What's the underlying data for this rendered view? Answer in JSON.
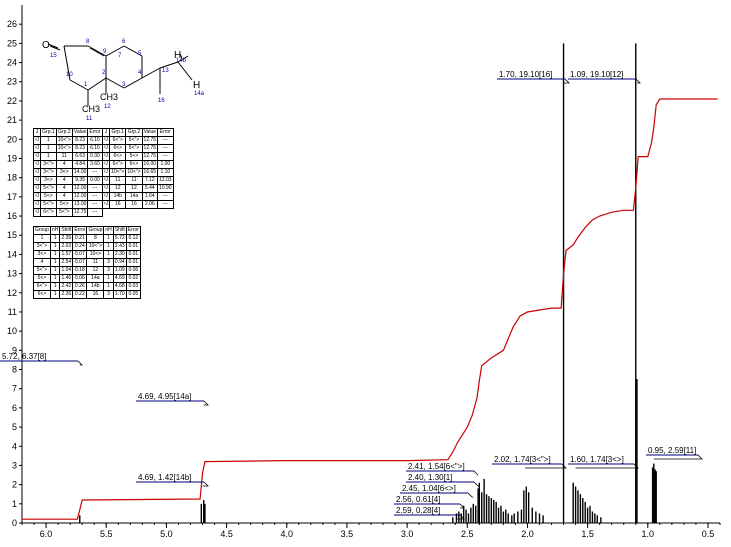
{
  "chart_data": {
    "type": "line",
    "title": "",
    "xlabel": "",
    "ylabel": "",
    "xlim": [
      6.2,
      0.4
    ],
    "ylim": [
      0,
      27
    ],
    "x_reversed": true,
    "x_ticks": [
      "6.0",
      "5.5",
      "5.0",
      "4.5",
      "4.0",
      "3.5",
      "3.0",
      "2.5",
      "2.0",
      "1.5",
      "1.0",
      "0.5"
    ],
    "y_ticks": [
      "0",
      "1",
      "2",
      "3",
      "4",
      "5",
      "6",
      "7",
      "8",
      "9",
      "10",
      "11",
      "12",
      "13",
      "14",
      "15",
      "16",
      "17",
      "18",
      "19",
      "20",
      "21",
      "22",
      "23",
      "24",
      "25",
      "26"
    ],
    "grid": false,
    "colors": {
      "integral": "#cc0000",
      "spectrum": "#000000",
      "label_border": "#000080"
    },
    "integral_curve": {
      "x": [
        6.2,
        5.74,
        5.72,
        5.7,
        4.72,
        4.7,
        4.68,
        4.0,
        3.0,
        2.66,
        2.62,
        2.58,
        2.54,
        2.5,
        2.46,
        2.42,
        2.4,
        2.38,
        2.3,
        2.2,
        2.12,
        2.06,
        2.0,
        1.9,
        1.8,
        1.72,
        1.7,
        1.68,
        1.62,
        1.58,
        1.52,
        1.46,
        1.4,
        1.3,
        1.2,
        1.12,
        1.1,
        1.08,
        1.0,
        0.97,
        0.95,
        0.93,
        0.9,
        0.6,
        0.42
      ],
      "y": [
        0.2,
        0.2,
        0.7,
        1.2,
        1.25,
        2.6,
        3.2,
        3.25,
        3.25,
        3.3,
        3.7,
        4.2,
        4.6,
        5.0,
        5.6,
        6.5,
        7.4,
        8.2,
        8.6,
        9.0,
        10.2,
        10.8,
        11.0,
        11.1,
        11.2,
        11.2,
        13.0,
        14.2,
        14.5,
        14.9,
        15.4,
        15.8,
        16.0,
        16.2,
        16.3,
        16.3,
        17.5,
        19.1,
        19.1,
        19.8,
        20.6,
        21.8,
        22.1,
        22.1,
        22.1
      ]
    },
    "peaks": [
      {
        "x": 5.72,
        "h": 0.4
      },
      {
        "x": 4.71,
        "h": 1.0
      },
      {
        "x": 4.69,
        "h": 1.2
      },
      {
        "x": 4.68,
        "h": 1.0
      },
      {
        "x": 2.62,
        "h": 0.3
      },
      {
        "x": 2.59,
        "h": 0.5
      },
      {
        "x": 2.57,
        "h": 0.6
      },
      {
        "x": 2.55,
        "h": 0.5
      },
      {
        "x": 2.53,
        "h": 0.9
      },
      {
        "x": 2.51,
        "h": 0.7
      },
      {
        "x": 2.49,
        "h": 0.5
      },
      {
        "x": 2.47,
        "h": 0.8
      },
      {
        "x": 2.45,
        "h": 1.0
      },
      {
        "x": 2.43,
        "h": 0.9
      },
      {
        "x": 2.41,
        "h": 1.8
      },
      {
        "x": 2.4,
        "h": 2.1
      },
      {
        "x": 2.38,
        "h": 1.6
      },
      {
        "x": 2.36,
        "h": 2.3
      },
      {
        "x": 2.34,
        "h": 1.5
      },
      {
        "x": 2.32,
        "h": 1.4
      },
      {
        "x": 2.3,
        "h": 1.3
      },
      {
        "x": 2.28,
        "h": 1.2
      },
      {
        "x": 2.26,
        "h": 1.1
      },
      {
        "x": 2.24,
        "h": 0.8
      },
      {
        "x": 2.22,
        "h": 0.9
      },
      {
        "x": 2.2,
        "h": 0.6
      },
      {
        "x": 2.18,
        "h": 0.7
      },
      {
        "x": 2.16,
        "h": 0.5
      },
      {
        "x": 2.13,
        "h": 0.4
      },
      {
        "x": 2.11,
        "h": 0.5
      },
      {
        "x": 2.08,
        "h": 0.6
      },
      {
        "x": 2.05,
        "h": 0.7
      },
      {
        "x": 2.03,
        "h": 1.7
      },
      {
        "x": 2.01,
        "h": 1.9
      },
      {
        "x": 1.99,
        "h": 1.6
      },
      {
        "x": 1.96,
        "h": 0.8
      },
      {
        "x": 1.93,
        "h": 0.6
      },
      {
        "x": 1.9,
        "h": 0.5
      },
      {
        "x": 1.87,
        "h": 0.4
      },
      {
        "x": 1.62,
        "h": 2.1
      },
      {
        "x": 1.6,
        "h": 1.9
      },
      {
        "x": 1.58,
        "h": 1.7
      },
      {
        "x": 1.56,
        "h": 1.5
      },
      {
        "x": 1.54,
        "h": 1.3
      },
      {
        "x": 1.52,
        "h": 1.1
      },
      {
        "x": 1.5,
        "h": 0.8
      },
      {
        "x": 1.48,
        "h": 0.9
      },
      {
        "x": 1.46,
        "h": 0.6
      },
      {
        "x": 1.44,
        "h": 0.5
      },
      {
        "x": 1.42,
        "h": 0.4
      },
      {
        "x": 1.39,
        "h": 0.3
      },
      {
        "x": 1.7,
        "h": 25.0
      },
      {
        "x": 1.1,
        "h": 25.0
      },
      {
        "x": 1.09,
        "h": 7.5
      },
      {
        "x": 0.96,
        "h": 2.9
      },
      {
        "x": 0.95,
        "h": 3.1
      },
      {
        "x": 0.94,
        "h": 2.8
      },
      {
        "x": 0.93,
        "h": 2.7
      }
    ],
    "annotations": [
      {
        "text": "5.72, 6.37[8]",
        "peak_x": 5.72
      },
      {
        "text": "4.69, 4.95[14a]",
        "peak_x": 4.69
      },
      {
        "text": "4.69, 1.42[14b]",
        "peak_x": 4.7
      },
      {
        "text": "2.41, 1.54[6<\">]",
        "peak_x": 2.41
      },
      {
        "text": "2.40, 1.30[1]",
        "peak_x": 2.4
      },
      {
        "text": "2.45, 1.04[6<>]",
        "peak_x": 2.45
      },
      {
        "text": "2.56, 0.61[4]",
        "peak_x": 2.56
      },
      {
        "text": "2.59, 0.28[4]",
        "peak_x": 2.59
      },
      {
        "text": "2.02, 1.74[3<\">]",
        "peak_x": 2.02
      },
      {
        "text": "1.60, 1.74[3<>]",
        "peak_x": 1.6
      },
      {
        "text": "1.70, 19.10[16]",
        "peak_x": 1.7
      },
      {
        "text": "1.09, 19.10[12]",
        "peak_x": 1.09
      },
      {
        "text": "0.95, 2.59[11]",
        "peak_x": 0.95
      }
    ],
    "molecule_labels": [
      "O",
      "15",
      "8",
      "9",
      "10",
      "1",
      "2",
      "3",
      "4",
      "5",
      "6",
      "7",
      "13",
      "14b",
      "14a",
      "CH3",
      "11",
      "CH3",
      "12",
      "16",
      "H",
      "H"
    ],
    "j_table": {
      "headers": [
        "J",
        "Grp.1",
        "Grp.2",
        "Value",
        "Error"
      ],
      "rows_left": [
        [
          "²J",
          "1",
          "10<\">",
          "8.23",
          "6.10"
        ],
        [
          "²J",
          "1",
          "10<\">",
          "8.23",
          "6.10"
        ],
        [
          "³J",
          "1",
          "11",
          "6.63",
          "0.30"
        ],
        [
          "³J",
          "3<\">",
          "4",
          "4.84",
          "3.60"
        ],
        [
          "²J",
          "3<\">",
          "3<>",
          "14.00",
          "---"
        ],
        [
          "³J",
          "3<>",
          "4",
          "9.35",
          "0.00"
        ],
        [
          "³J",
          "5<\">",
          "4",
          "12.00",
          "---"
        ],
        [
          "²J",
          "5<>",
          "4",
          "12.00",
          "---"
        ],
        [
          "²J",
          "5<\">",
          "5<>",
          "13.00",
          "---"
        ],
        [
          "³J",
          "6<\">",
          "5<\">",
          "12.75",
          "---"
        ]
      ],
      "rows_right": [
        [
          "³J",
          "6<\">",
          "5<\">",
          "12.75",
          "---"
        ],
        [
          "³J",
          "6<>",
          "5<\">",
          "12.75",
          "---"
        ],
        [
          "³J",
          "6<>",
          "5<>",
          "12.75",
          "---"
        ],
        [
          "²J",
          "6<\">",
          "6<>",
          "16.00",
          "1.00"
        ],
        [
          "²J",
          "10<\">",
          "10<\">",
          "16.65",
          "1.10"
        ],
        [
          "³J",
          "11",
          "11",
          "7.12",
          "12.03"
        ],
        [
          "³J",
          "12",
          "12",
          "5.44",
          "10.90"
        ],
        [
          "²J",
          "14b",
          "14a",
          "1.64",
          "---"
        ],
        [
          "⁴J",
          "16",
          "16",
          "2.06",
          "---"
        ]
      ]
    },
    "shift_table": {
      "headers": [
        "Group",
        "nH",
        "Shift",
        "Error",
        "Group",
        "nH",
        "Shift",
        "Error"
      ],
      "rows": [
        [
          "1",
          "1",
          "2.39",
          "0.21",
          "8",
          "1",
          "5.72",
          "0.12"
        ],
        [
          "3<\">",
          "1",
          "2.03",
          "0.24",
          "10<\">",
          "1",
          "2.43",
          "0.01"
        ],
        [
          "3<>",
          "1",
          "1.57",
          "0.07",
          "10<>",
          "1",
          "2.30",
          "0.01"
        ],
        [
          "4",
          "1",
          "2.54",
          "0.07",
          "11",
          "3",
          "0.94",
          "0.01"
        ],
        [
          "5<\">",
          "1",
          "1.04",
          "0.18",
          "12",
          "3",
          "1.09",
          "0.06"
        ],
        [
          "5<>",
          "1",
          "1.46",
          "0.06",
          "14a",
          "1",
          "4.69",
          "0.02"
        ],
        [
          "6<\">",
          "1",
          "2.42",
          "0.26",
          "14b",
          "1",
          "4.68",
          "0.03"
        ],
        [
          "6<>",
          "1",
          "2.26",
          "0.22",
          "16",
          "3",
          "1.70",
          "0.05"
        ]
      ]
    }
  }
}
